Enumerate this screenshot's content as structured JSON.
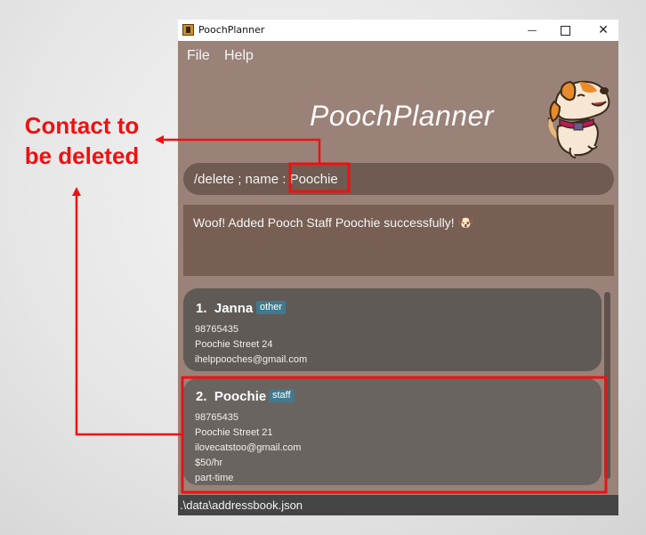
{
  "window": {
    "title": "PoochPlanner",
    "close_glyph": "✕"
  },
  "menu": [
    {
      "label": "File"
    },
    {
      "label": "Help"
    }
  ],
  "header": {
    "title": "PoochPlanner"
  },
  "command": {
    "value": "/delete ; name : Poochie"
  },
  "result": {
    "message": "Woof! Added Pooch Staff Poochie successfully! 🐶"
  },
  "contacts": [
    {
      "index": "1.",
      "name": "Janna",
      "tag": "other",
      "phone": "98765435",
      "address": "Poochie Street 24",
      "email": "ihelppooches@gmail.com"
    },
    {
      "index": "2.",
      "name": "Poochie",
      "tag": "staff",
      "phone": "98765435",
      "address": "Poochie Street 21",
      "email": "ilovecatstoo@gmail.com",
      "salary": "$50/hr",
      "employment": "part-time"
    }
  ],
  "status": {
    "path": ".\\data\\addressbook.json"
  },
  "annotation": {
    "line1": "Contact to",
    "line2": "be deleted",
    "color": "#ee1111"
  },
  "colors": {
    "window_bg": "#9a8279",
    "command_bg": "#6f5b51",
    "result_bg": "#775f53",
    "card_bg": "#5f5a56",
    "tag_bg": "#3f7a8f"
  }
}
